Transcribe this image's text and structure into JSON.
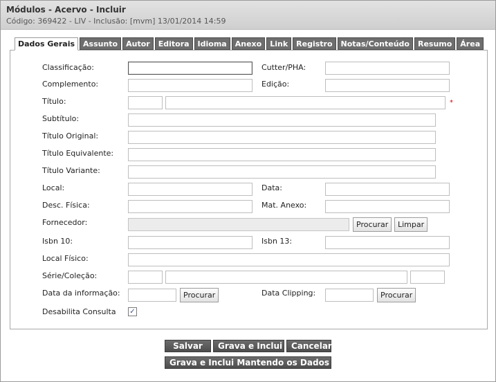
{
  "header": {
    "title": "Módulos - Acervo - Incluir",
    "subtitle": "Código: 369422 - LIV - Inclusão: [mvm] 13/01/2014 14:59"
  },
  "tabs": [
    "Dados Gerais",
    "Assunto",
    "Autor",
    "Editora",
    "Idioma",
    "Anexo",
    "Link",
    "Registro",
    "Notas/Conteúdo",
    "Resumo",
    "Área"
  ],
  "active_tab": "Dados Gerais",
  "form": {
    "classificacao": "Classificação:",
    "cutter": "Cutter/PHA:",
    "complemento": "Complemento:",
    "edicao": "Edição:",
    "titulo": "Título:",
    "subtitulo": "Subtítulo:",
    "titulo_original": "Título Original:",
    "titulo_equivalente": "Título Equivalente:",
    "titulo_variante": "Título Variante:",
    "local": "Local:",
    "data": "Data:",
    "desc_fisica": "Desc. Física:",
    "mat_anexo": "Mat. Anexo:",
    "fornecedor": "Fornecedor:",
    "isbn10": "Isbn 10:",
    "isbn13": "Isbn 13:",
    "local_fisico": "Local Físico:",
    "serie_colecao": "Série/Coleção:",
    "data_informacao": "Data da informação:",
    "data_clipping": "Data Clipping:",
    "desabilita_consulta": "Desabilita Consulta",
    "required_mark": "*",
    "checkbox_mark": "✓"
  },
  "buttons": {
    "procurar": "Procurar",
    "limpar": "Limpar",
    "salvar": "Salvar",
    "grava_inclui": "Grava e Inclui",
    "cancelar": "Cancelar",
    "grava_inclui_mantendo": "Grava e Inclui Mantendo os Dados"
  },
  "state": {
    "desabilita_consulta_checked": true
  }
}
